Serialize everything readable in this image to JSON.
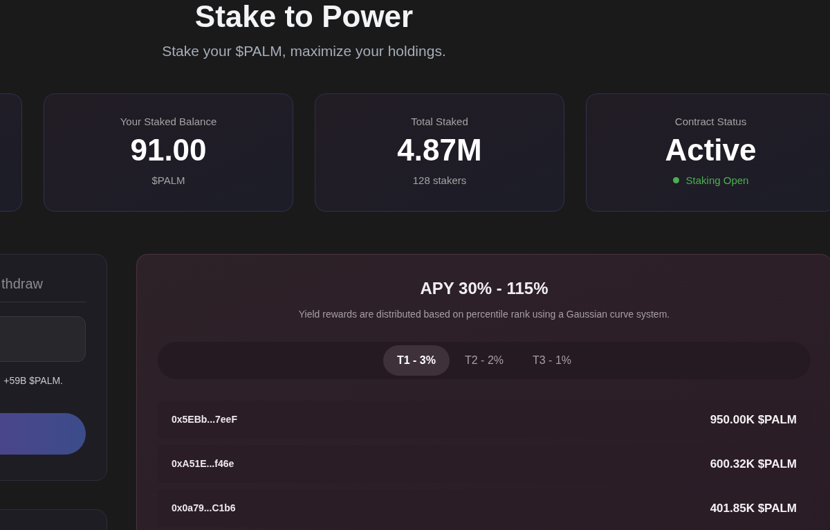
{
  "hero": {
    "title": "Stake to Power",
    "subtitle": "Stake your $PALM, maximize your holdings."
  },
  "stats": [
    {
      "kind": "empty"
    },
    {
      "kind": "plain",
      "label": "Your Staked Balance",
      "value": "91.00",
      "note": "$PALM"
    },
    {
      "kind": "plain",
      "label": "Total Staked",
      "value": "4.87M",
      "note": "128 stakers"
    },
    {
      "kind": "status",
      "label": "Contract Status",
      "value": "Active",
      "note": "Staking Open",
      "color": "#4caf50"
    }
  ],
  "stake_panel": {
    "tab": "thdraw",
    "hint": "+59B $PALM."
  },
  "apy_panel": {
    "title": "APY 30% - 115%",
    "description": "Yield rewards are distributed based on percentile rank using a Gaussian curve system.",
    "tabs": [
      {
        "label": "T1 - 3%",
        "selected": true
      },
      {
        "label": "T2 - 2%",
        "selected": false
      },
      {
        "label": "T3 - 1%",
        "selected": false
      }
    ],
    "rows": [
      {
        "address": "0x5EBb...7eeF",
        "amount": "950.00K $PALM"
      },
      {
        "address": "0xA51E...f46e",
        "amount": "600.32K $PALM"
      },
      {
        "address": "0x0a79...C1b6",
        "amount": "401.85K $PALM"
      }
    ]
  }
}
